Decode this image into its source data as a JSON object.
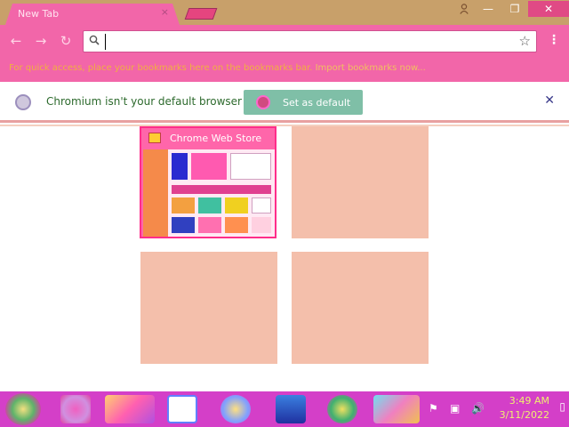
{
  "window": {
    "tab_title": "New Tab",
    "tab_close": "×",
    "minimize": "—",
    "maximize": "❐",
    "close": "✕",
    "user_icon": "person-icon"
  },
  "toolbar": {
    "back": "←",
    "forward": "→",
    "reload": "↻",
    "omnibox_value": "",
    "omnibox_placeholder": "",
    "star": "☆",
    "menu": "⋮"
  },
  "bookmarks": {
    "prompt": "For quick access, place your bookmarks here on the bookmarks bar.",
    "import_link": "Import bookmarks now..."
  },
  "infobar": {
    "message": "Chromium isn't your default browser",
    "button_label": "Set as default",
    "close": "✕"
  },
  "most_visited": [
    {
      "title": "Chrome Web Store",
      "has_thumbnail": true
    },
    {
      "title": "",
      "has_thumbnail": false
    },
    {
      "title": "",
      "has_thumbnail": false
    },
    {
      "title": "",
      "has_thumbnail": false
    }
  ],
  "taskbar": {
    "pinned_apps": [
      "start-orb",
      "media-app",
      "files-app",
      "video-app",
      "paint-app",
      "book-app",
      "media-player-app",
      "chromium-app"
    ],
    "time": "3:49 AM",
    "date": "3/11/2022",
    "tray": {
      "flag": "⚑",
      "network": "▣",
      "volume": "🔊"
    },
    "show_desktop": "▯"
  },
  "colors": {
    "accent": "#f266a9",
    "infobar_button": "#7fbfa7",
    "tile_empty": "#f4bfab",
    "taskbar": "#d43fc8"
  }
}
